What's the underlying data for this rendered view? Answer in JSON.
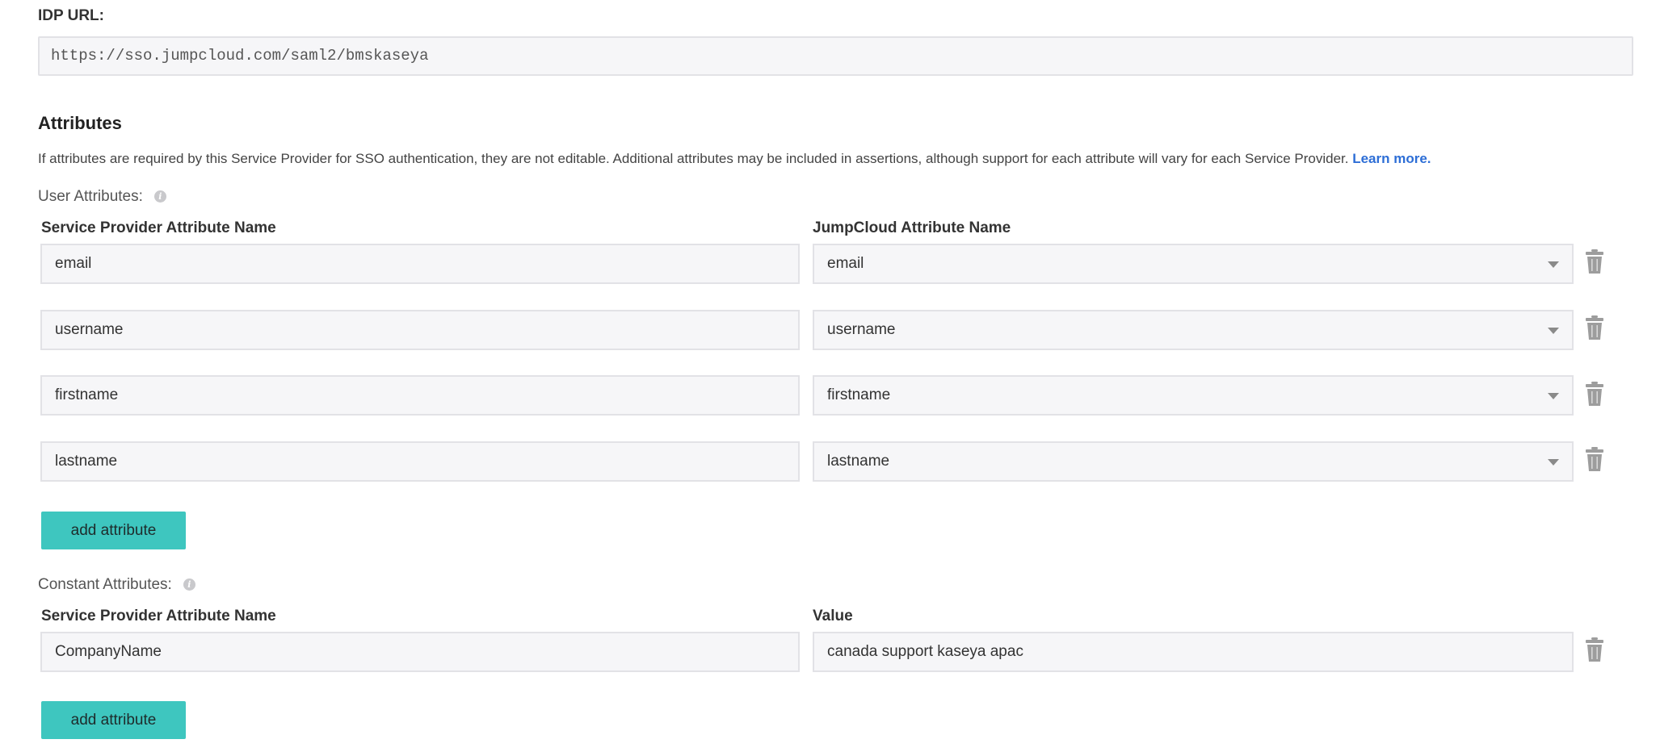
{
  "idp": {
    "label": "IDP URL:",
    "value": "https://sso.jumpcloud.com/saml2/bmskaseya"
  },
  "attributes": {
    "title": "Attributes",
    "description": "If attributes are required by this Service Provider for SSO authentication, they are not editable. Additional attributes may be included in assertions, although support for each attribute will vary for each Service Provider.",
    "learn_more": "Learn more.",
    "user": {
      "label": "User Attributes:",
      "col_sp": "Service Provider Attribute Name",
      "col_jc": "JumpCloud Attribute Name",
      "rows": [
        {
          "sp": "email",
          "jc": "email"
        },
        {
          "sp": "username",
          "jc": "username"
        },
        {
          "sp": "firstname",
          "jc": "firstname"
        },
        {
          "sp": "lastname",
          "jc": "lastname"
        }
      ],
      "add_button": "add attribute"
    },
    "constant": {
      "label": "Constant Attributes:",
      "col_sp": "Service Provider Attribute Name",
      "col_value": "Value",
      "rows": [
        {
          "sp": "CompanyName",
          "value": "canada support kaseya apac"
        }
      ],
      "add_button": "add attribute"
    }
  },
  "icons": {
    "info": "info-icon",
    "trash": "trash-icon",
    "dropdown": "chevron-down-icon"
  },
  "colors": {
    "accent_button": "#3ec6bf",
    "link": "#2d6ed6"
  }
}
